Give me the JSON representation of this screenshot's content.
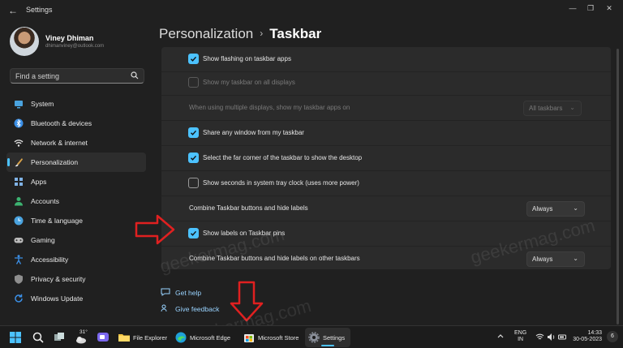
{
  "window": {
    "title": "Settings"
  },
  "profile": {
    "name": "Viney Dhiman",
    "email": "dhimanviney@outlook.com"
  },
  "search": {
    "placeholder": "Find a setting"
  },
  "nav": [
    {
      "label": "System",
      "icon": "monitor-icon",
      "color": "#4aa3df"
    },
    {
      "label": "Bluetooth & devices",
      "icon": "bluetooth-icon",
      "color": "#3b8fe6"
    },
    {
      "label": "Network & internet",
      "icon": "wifi-icon",
      "color": "#e6e6e6"
    },
    {
      "label": "Personalization",
      "icon": "paint-brush-icon",
      "color": "#d9a34a",
      "active": true
    },
    {
      "label": "Apps",
      "icon": "apps-icon",
      "color": "#7fb2e5"
    },
    {
      "label": "Accounts",
      "icon": "person-icon",
      "color": "#3cb371"
    },
    {
      "label": "Time & language",
      "icon": "globe-clock-icon",
      "color": "#4aa3df"
    },
    {
      "label": "Gaming",
      "icon": "gamepad-icon",
      "color": "#bcbcbc"
    },
    {
      "label": "Accessibility",
      "icon": "accessibility-icon",
      "color": "#3b8fe6"
    },
    {
      "label": "Privacy & security",
      "icon": "shield-icon",
      "color": "#8e8e8e"
    },
    {
      "label": "Windows Update",
      "icon": "update-icon",
      "color": "#3b8fe6"
    }
  ],
  "breadcrumb": {
    "parent": "Personalization",
    "separator": "›",
    "current": "Taskbar"
  },
  "settings": [
    {
      "label": "Show flashing on taskbar apps",
      "control": "checkbox",
      "checked": true
    },
    {
      "label": "Show my taskbar on all displays",
      "control": "checkbox",
      "checked": false,
      "disabled": true
    },
    {
      "label": "When using multiple displays, show my taskbar apps on",
      "control": "dropdown",
      "value": "All taskbars",
      "disabled": true
    },
    {
      "label": "Share any window from my taskbar",
      "control": "checkbox",
      "checked": true
    },
    {
      "label": "Select the far corner of the taskbar to show the desktop",
      "control": "checkbox",
      "checked": true
    },
    {
      "label": "Show seconds in system tray clock (uses more power)",
      "control": "checkbox",
      "checked": false
    },
    {
      "label": "Combine Taskbar buttons and hide labels",
      "control": "dropdown",
      "value": "Always"
    },
    {
      "label": "Show labels on Taskbar pins",
      "control": "checkbox",
      "checked": true
    },
    {
      "label": "Combine Taskbar buttons and hide labels on other taskbars",
      "control": "dropdown",
      "value": "Always"
    }
  ],
  "links": [
    {
      "label": "Get help",
      "icon": "help-icon"
    },
    {
      "label": "Give feedback",
      "icon": "feedback-icon"
    }
  ],
  "watermarks": [
    "geekermag.com",
    "geekermag.com",
    "geekermag.com"
  ],
  "taskbar": {
    "weather_temp": "31°",
    "apps": [
      {
        "label": "File Explorer",
        "icon": "folder-icon"
      },
      {
        "label": "Microsoft Edge",
        "icon": "edge-icon"
      },
      {
        "label": "Microsoft Store",
        "icon": "store-icon"
      },
      {
        "label": "Settings",
        "icon": "gear-icon",
        "active": true
      }
    ],
    "lang_top": "ENG",
    "lang_bottom": "IN",
    "time": "14:33",
    "date": "30-05-2023",
    "notif_count": "6"
  },
  "colors": {
    "accent": "#4cc2ff",
    "background": "#202020",
    "card": "#2b2b2b",
    "link": "#99d3ff",
    "annotation_arrow": "#e02020"
  }
}
